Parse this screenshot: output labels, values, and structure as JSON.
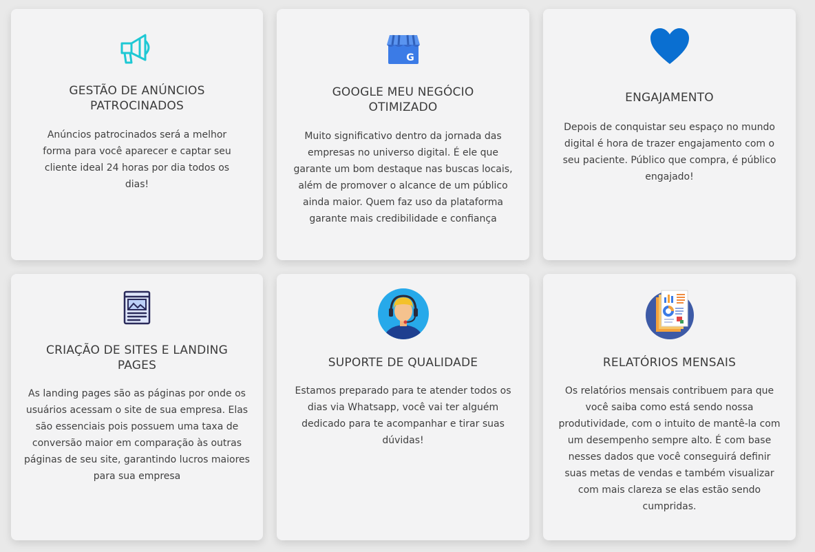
{
  "cards": [
    {
      "icon": "megaphone-icon",
      "title": "GESTÃO DE ANÚNCIOS PATROCINADOS",
      "description": "Anúncios patrocinados será a melhor forma para você aparecer e captar seu cliente ideal 24 horas por dia todos os dias!"
    },
    {
      "icon": "google-my-business-icon",
      "title": "GOOGLE MEU NEGÓCIO OTIMIZADO",
      "description": "Muito significativo dentro da jornada das empresas no universo digital. É ele que garante um bom destaque nas buscas locais, além de promover o alcance de um público ainda maior. Quem faz uso da plataforma garante mais credibilidade e confiança"
    },
    {
      "icon": "heart-icon",
      "title": "ENGAJAMENTO",
      "description": "Depois de conquistar seu espaço no mundo digital é hora de trazer engajamento com o seu paciente. Público que compra, é público engajado!"
    },
    {
      "icon": "landing-page-icon",
      "title": "CRIAÇÃO DE SITES E LANDING PAGES",
      "description": "As landing pages são as páginas por onde os usuários acessam o site de sua empresa. Elas são essenciais pois possuem uma taxa de conversão maior em comparação às outras páginas de seu site, garantindo lucros maiores para sua empresa"
    },
    {
      "icon": "support-agent-icon",
      "title": "SUPORTE DE QUALIDADE",
      "description": "Estamos preparado para te atender todos os dias via Whatsapp, você vai ter alguém dedicado para te acompanhar e tirar suas dúvidas!"
    },
    {
      "icon": "report-icon",
      "title": "RELATÓRIOS MENSAIS",
      "description": "Os relatórios mensais contribuem para que você saiba como está sendo nossa produtividade, com o intuito de mantê-la com um desempenho sempre alto. É com base nesses dados que você conseguirá definir suas metas de vendas e também visualizar com mais clareza se elas estão sendo cumpridas."
    }
  ],
  "colors": {
    "background": "#e9e9e9",
    "card": "#f3f3f4",
    "heart": "#0a6fd1",
    "megaphone": "#1ec8d4"
  }
}
